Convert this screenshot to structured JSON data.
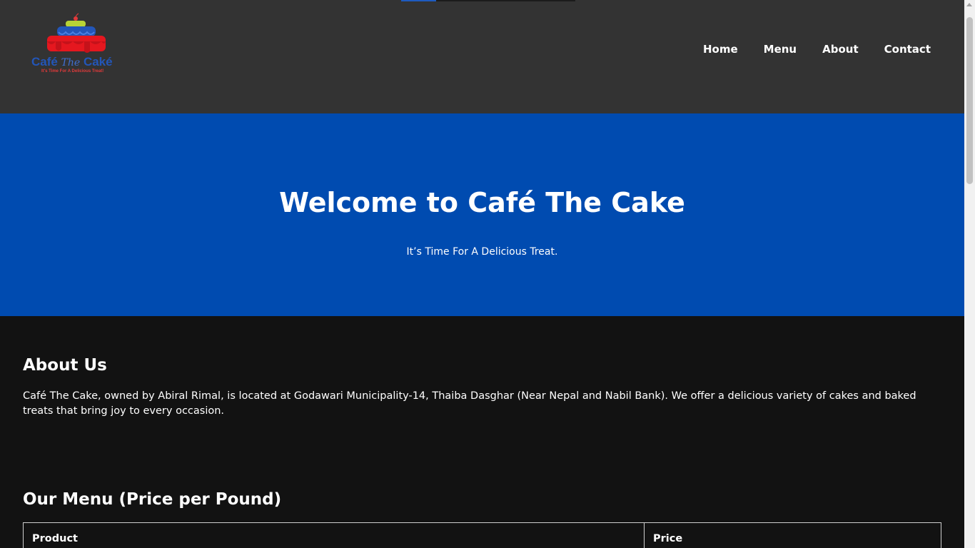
{
  "header": {
    "logo": {
      "brand_part1": "Café ",
      "brand_part2": "The",
      "brand_part3": " Caké",
      "slogan": "It's Time For A Delicious Treat!"
    },
    "progress_fraction": 0.2,
    "nav": [
      {
        "label": "Home"
      },
      {
        "label": "Menu"
      },
      {
        "label": "About"
      },
      {
        "label": "Contact"
      }
    ]
  },
  "hero": {
    "title": "Welcome to Café The Cake",
    "subtitle": "It’s Time For A Delicious Treat."
  },
  "about": {
    "heading": "About Us",
    "text": "Café The Cake, owned by Abiral Rimal, is located at Godawari Municipality-14, Thaiba Dasghar (Near Nepal and Nabil Bank). We offer a delicious variety of cakes and baked treats that bring joy to every occasion."
  },
  "menu": {
    "heading": "Our Menu (Price per Pound)",
    "columns": [
      "Product",
      "Price"
    ]
  },
  "colors": {
    "header_bg": "#333333",
    "hero_bg": "#004bb0",
    "page_bg": "#121212",
    "brand_blue": "#2356b8",
    "brand_red": "#e23a3a"
  }
}
